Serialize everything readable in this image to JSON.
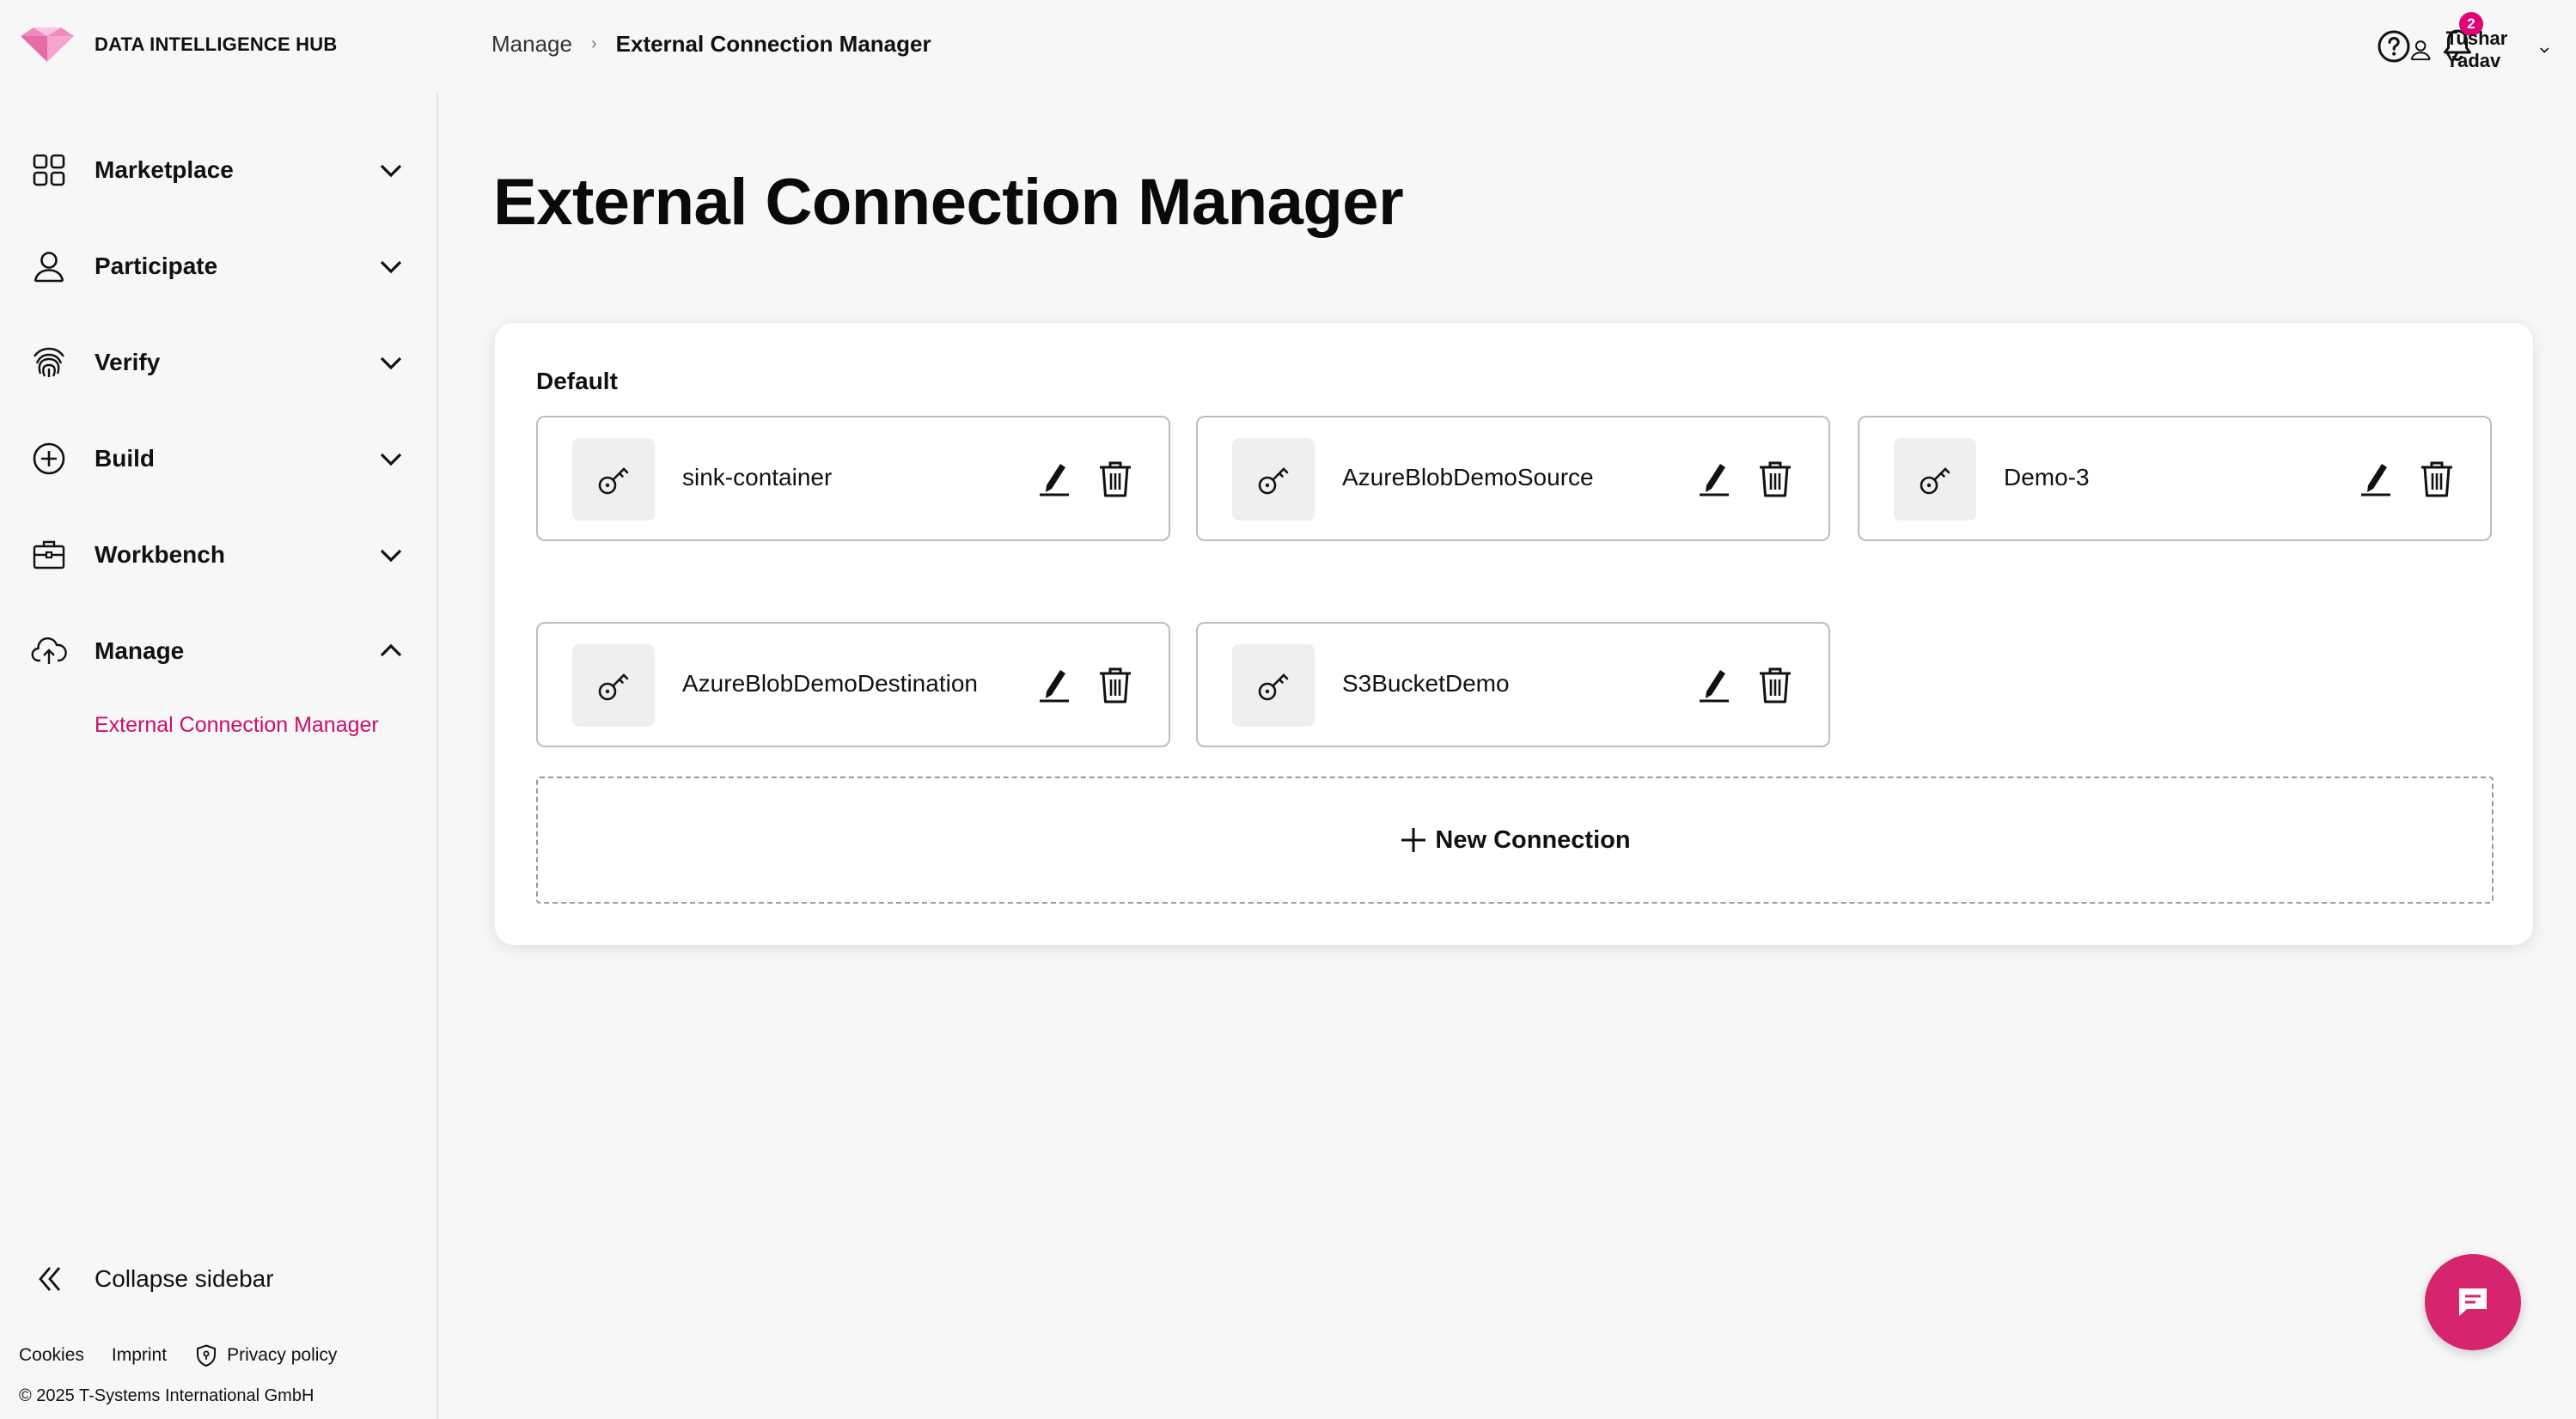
{
  "brand": {
    "name": "DATA INTELLIGENCE HUB",
    "accent": "#e20074"
  },
  "breadcrumb": {
    "parent": "Manage",
    "separator": "›",
    "current": "External Connection Manager"
  },
  "header": {
    "notifications_count": "2",
    "user_name": "Tushar Yadav",
    "icons": [
      "help-icon",
      "bell-icon",
      "user-icon",
      "chevron-down-icon"
    ]
  },
  "sidebar": {
    "items": [
      {
        "label": "Marketplace",
        "icon": "grid-icon",
        "expanded": false
      },
      {
        "label": "Participate",
        "icon": "person-icon",
        "expanded": false
      },
      {
        "label": "Verify",
        "icon": "fingerprint-icon",
        "expanded": false
      },
      {
        "label": "Build",
        "icon": "plus-circle-icon",
        "expanded": false
      },
      {
        "label": "Workbench",
        "icon": "briefcase-icon",
        "expanded": false
      },
      {
        "label": "Manage",
        "icon": "cloud-upload-icon",
        "expanded": true
      }
    ],
    "manage_subitem": "External Connection Manager",
    "collapse_label": "Collapse sidebar",
    "footer": {
      "cookies": "Cookies",
      "imprint": "Imprint",
      "privacy": "Privacy policy",
      "copyright": "© 2025 T-Systems International GmbH"
    }
  },
  "main": {
    "title": "External Connection Manager",
    "group_label": "Default",
    "connections": [
      {
        "name": "sink-container"
      },
      {
        "name": "AzureBlobDemoSource"
      },
      {
        "name": "Demo-3"
      },
      {
        "name": "AzureBlobDemoDestination"
      },
      {
        "name": "S3BucketDemo"
      }
    ],
    "new_connection_label": "New Connection"
  },
  "colors": {
    "active_link": "#c8106e",
    "chat_button": "#d6246e"
  }
}
